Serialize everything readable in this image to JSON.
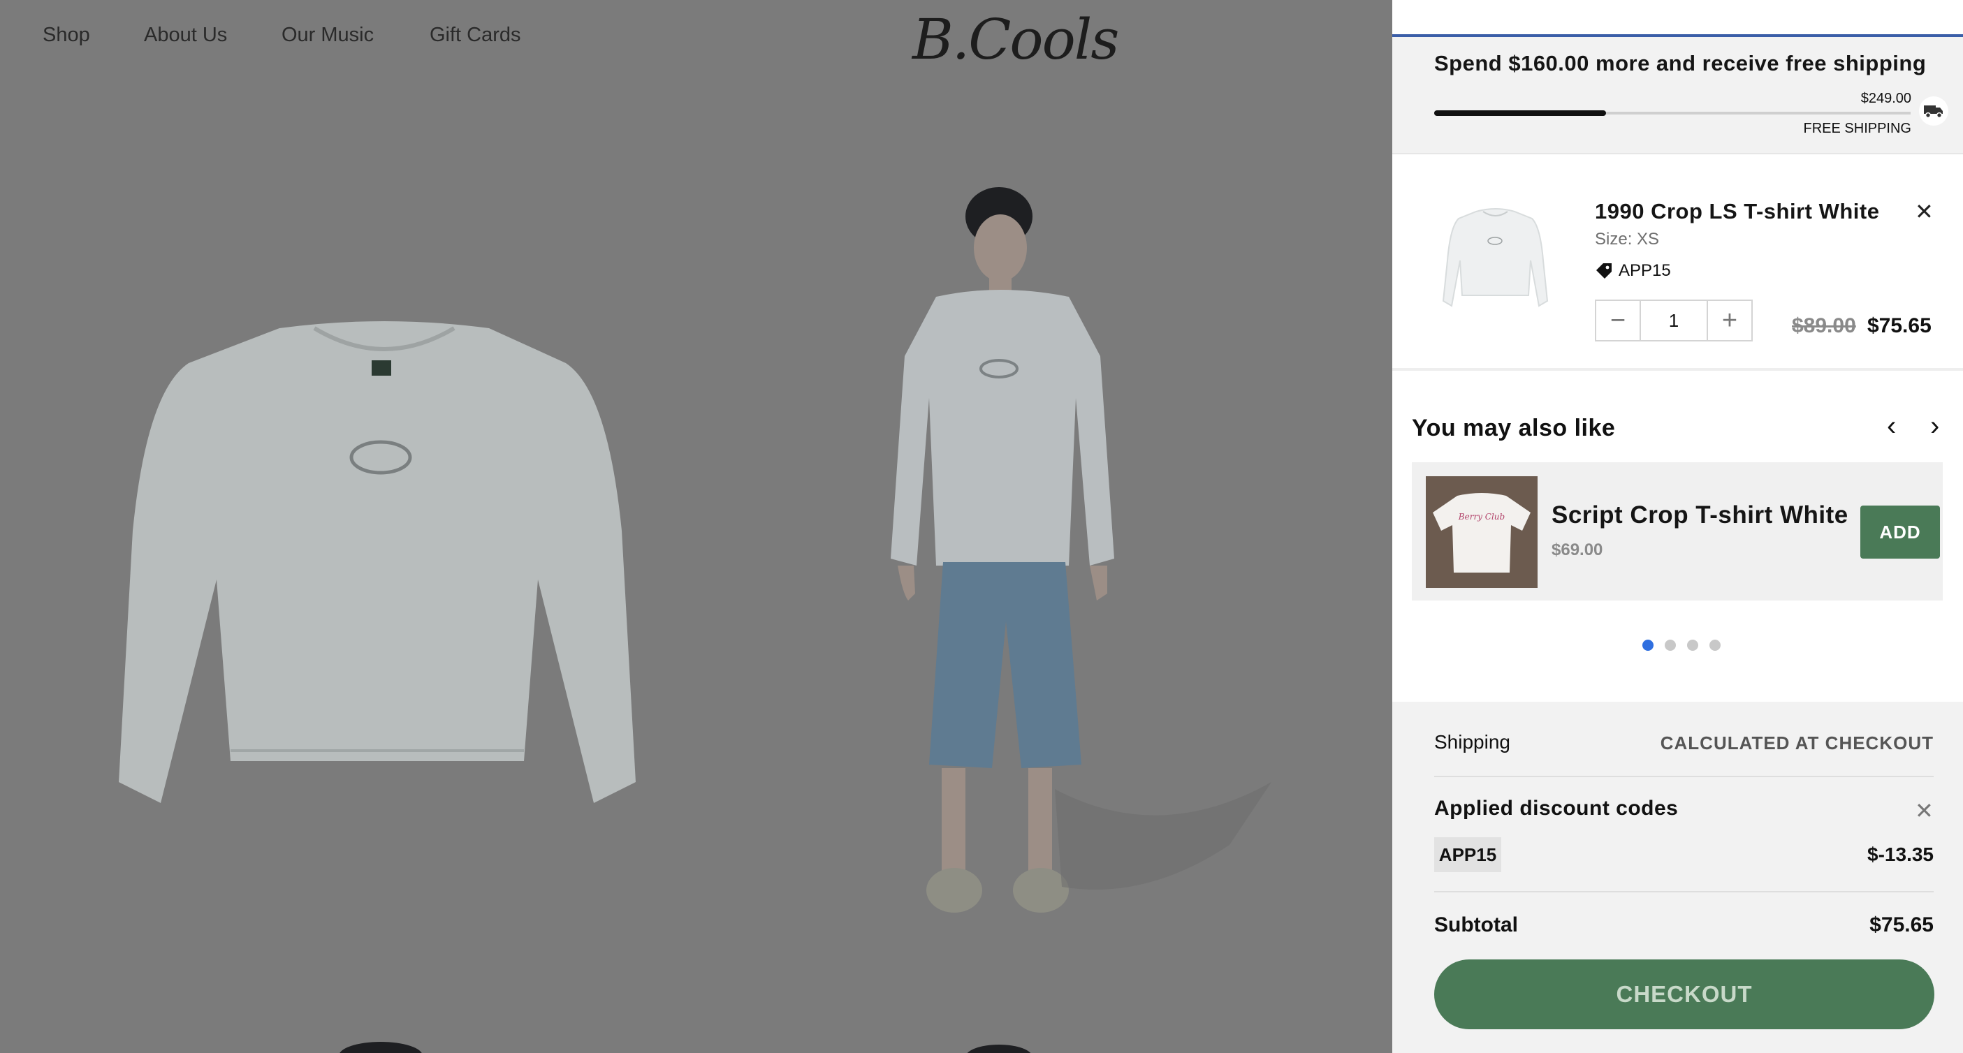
{
  "nav": {
    "items": [
      "Shop",
      "About Us",
      "Our Music",
      "Gift Cards"
    ],
    "logo": "B.Cools"
  },
  "cart": {
    "shipping_banner": {
      "message": "Spend $160.00 more and receive free shipping",
      "threshold": "$249.00",
      "label": "FREE SHIPPING",
      "progress": 0.36
    },
    "item": {
      "title": "1990 Crop LS T-shirt White",
      "size": "Size: XS",
      "discount_code": "APP15",
      "quantity": "1",
      "price_original": "$89.00",
      "price_discounted": "$75.65"
    },
    "recommendations": {
      "title": "You may also like",
      "product": {
        "name": "Script Crop T-shirt White",
        "price": "$69.00"
      },
      "add_label": "ADD",
      "page_count": 4,
      "active_page": 1
    },
    "summary": {
      "shipping_label": "Shipping",
      "shipping_value": "CALCULATED AT CHECKOUT",
      "discounts_label": "Applied discount codes",
      "code": "APP15",
      "code_amount": "$-13.35",
      "subtotal_label": "Subtotal",
      "subtotal_value": "$75.65",
      "checkout_label": "CHECKOUT"
    }
  },
  "colors": {
    "accent_green": "#4a7a57",
    "dot_active": "#2f6fe0",
    "overlay_bg": "#7b7b7b"
  }
}
